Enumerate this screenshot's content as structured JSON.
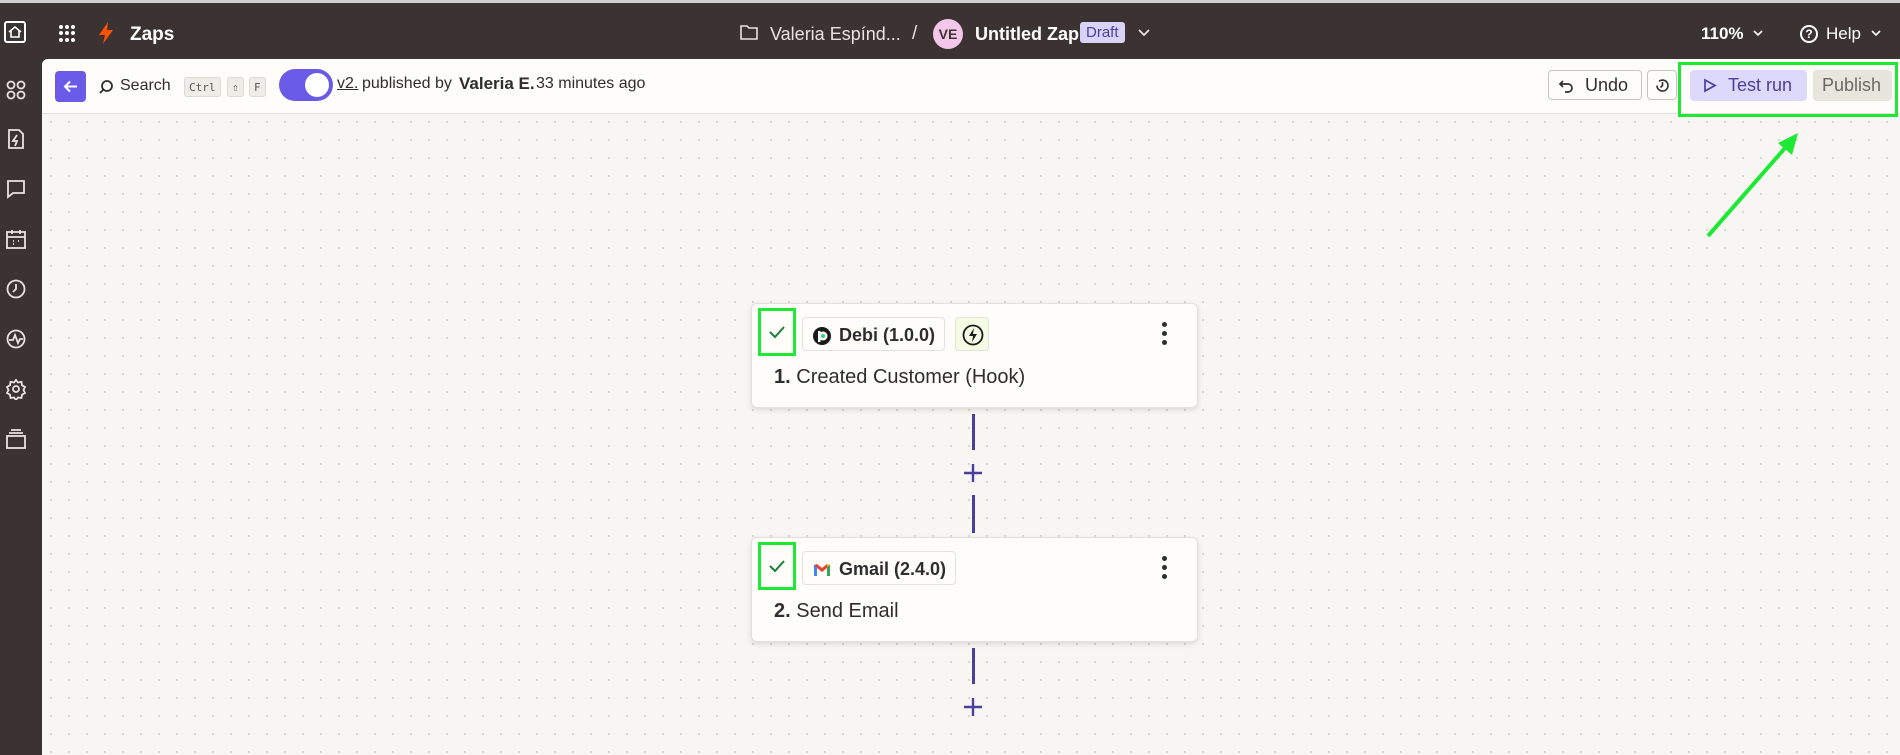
{
  "topbar": {
    "app_name": "Zaps",
    "folder_name": "Valeria Espínd...",
    "separator": "/",
    "avatar_initials": "VE",
    "zap_name": "Untitled Zap",
    "status_badge": "Draft",
    "zoom": "110%",
    "help_label": "Help"
  },
  "left_rail": {
    "icons": [
      "zaps-icon",
      "interfaces-icon",
      "chatbots-icon",
      "tables-icon",
      "history-icon",
      "activity-icon",
      "settings-icon",
      "layers-icon"
    ]
  },
  "toolbar": {
    "search_label": "Search",
    "shortcut_keys": [
      "Ctrl",
      "⇧",
      "F"
    ],
    "version_link": "v2.",
    "published_by_text": "published by",
    "author": "Valeria E.",
    "time_ago": "33 minutes ago",
    "undo_label": "Undo",
    "test_run_label": "Test run",
    "publish_label": "Publish"
  },
  "steps": [
    {
      "number": "1.",
      "title": "Created Customer (Hook)",
      "app": "Debi (1.0.0)",
      "app_icon": "debi-icon",
      "trigger": true
    },
    {
      "number": "2.",
      "title": "Send Email",
      "app": "Gmail (2.4.0)",
      "app_icon": "gmail-icon",
      "trigger": false
    }
  ],
  "colors": {
    "topbar_bg": "#3b3332",
    "accent": "#695be8",
    "highlight": "#1de935",
    "canvas_bg": "#f7f6f2"
  }
}
